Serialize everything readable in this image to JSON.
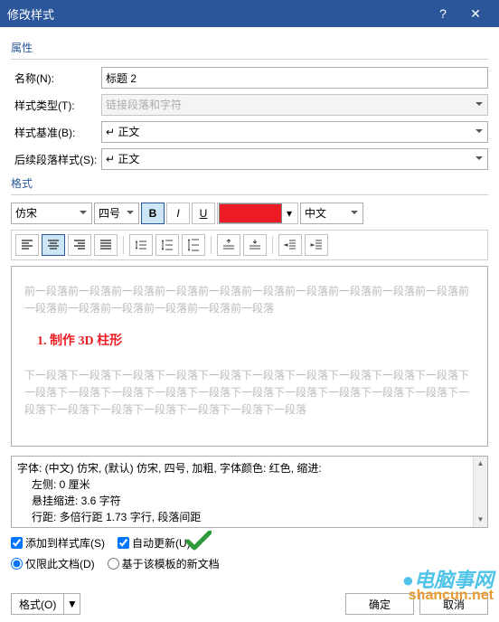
{
  "titlebar": {
    "title": "修改样式"
  },
  "section": {
    "props": "属性",
    "format": "格式"
  },
  "labels": {
    "name": "名称(N):",
    "styleType": "样式类型(T):",
    "basedOn": "样式基准(B):",
    "following": "后续段落样式(S):"
  },
  "fields": {
    "name": "标题 2",
    "styleType": "链接段落和字符",
    "basedOn": "↵ 正文",
    "following": "↵ 正文"
  },
  "toolbar": {
    "font": "仿宋",
    "size": "四号",
    "lang": "中文",
    "color": "#ed1c24"
  },
  "preview": {
    "grey1": "前一段落前一段落前一段落前一段落前一段落前一段落前一段落前一段落前一段落前一段落前一段落前一段落前一段落前一段落前一段落前一段落",
    "sample": "1. 制作 3D 柱形",
    "grey2": "下一段落下一段落下一段落下一段落下一段落下一段落下一段落下一段落下一段落下一段落下一段落下一段落下一段落下一段落下一段落下一段落下一段落下一段落下一段落下一段落下一段落下一段落下一段落下一段落下一段落下一段落下一段落"
  },
  "desc": {
    "line1": "字体: (中文) 仿宋, (默认) 仿宋, 四号, 加粗, 字体颜色: 红色, 缩进:",
    "line2": "左侧: 0 厘米",
    "line3": "悬挂缩进: 3.6 字符",
    "line4": "行距: 多倍行距 1.73 字行, 段落间距"
  },
  "checks": {
    "addToGallery": "添加到样式库(S)",
    "autoUpdate": "自动更新(U)"
  },
  "radios": {
    "thisDoc": "仅限此文档(D)",
    "template": "基于该模板的新文档"
  },
  "footer": {
    "format": "格式(O)",
    "ok": "确定",
    "cancel": "取消"
  },
  "watermark": {
    "main": "●电脑事网",
    "sub": "shancun.net"
  }
}
